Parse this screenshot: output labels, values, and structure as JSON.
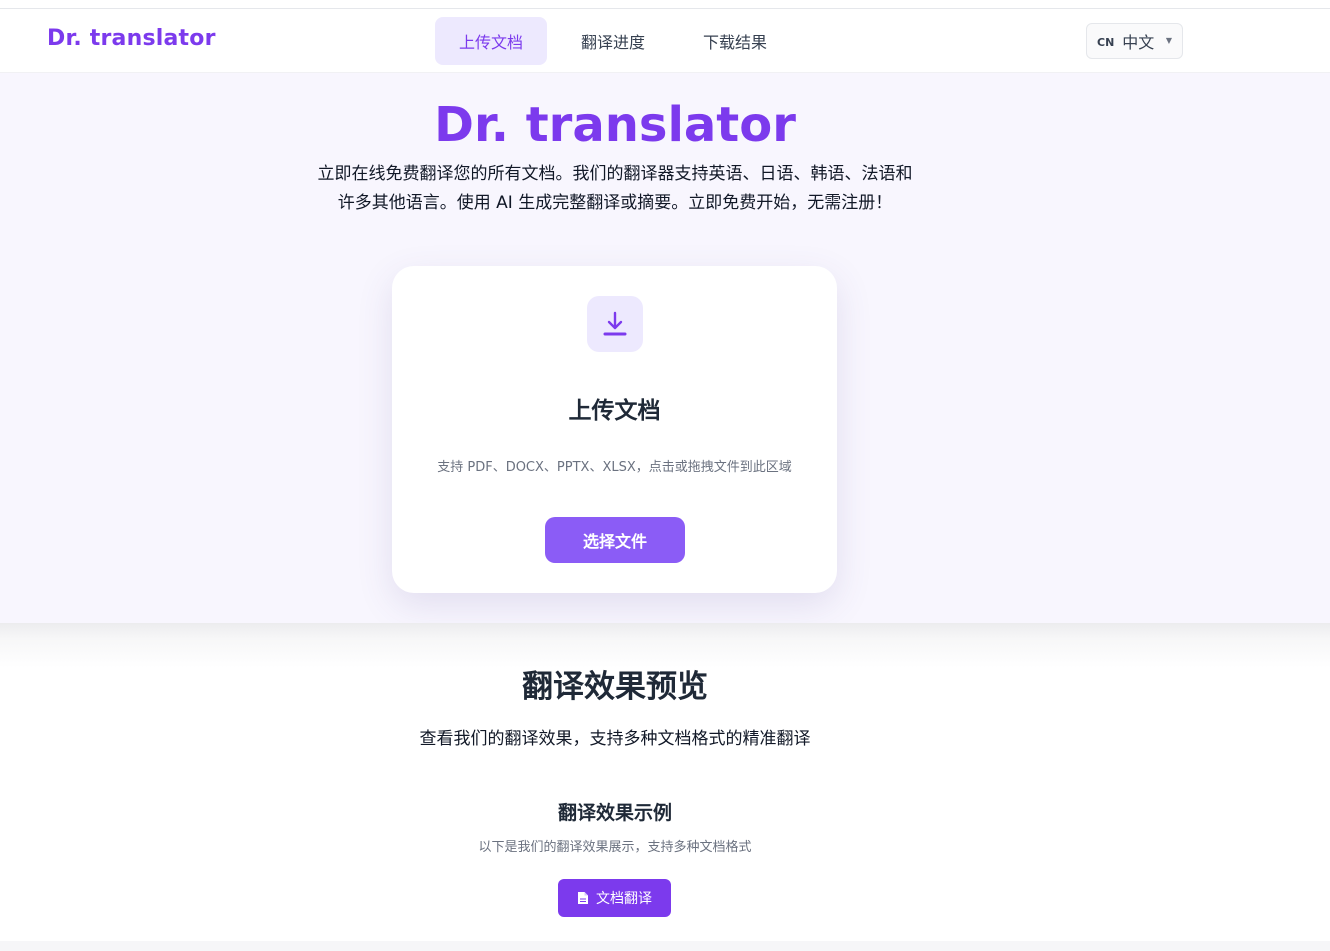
{
  "header": {
    "logo": "Dr. translator",
    "nav": [
      {
        "label": "上传文档",
        "active": true
      },
      {
        "label": "翻译进度",
        "active": false
      },
      {
        "label": "下载结果",
        "active": false
      }
    ],
    "language": {
      "code": "CN",
      "label": "中文"
    }
  },
  "hero": {
    "title": "Dr. translator",
    "description": "立即在线免费翻译您的所有文档。我们的翻译器支持英语、日语、韩语、法语和许多其他语言。使用 AI 生成完整翻译或摘要。立即免费开始，无需注册！"
  },
  "upload": {
    "icon": "download-icon",
    "title": "上传文档",
    "hint": "支持 PDF、DOCX、PPTX、XLSX，点击或拖拽文件到此区域",
    "button": "选择文件"
  },
  "preview": {
    "title": "翻译效果预览",
    "subtitle": "查看我们的翻译效果，支持多种文档格式的精准翻译",
    "example_title": "翻译效果示例",
    "example_subtitle": "以下是我们的翻译效果展示，支持多种文档格式",
    "doc_button": "文档翻译",
    "doc_button_icon": "document-icon"
  },
  "colors": {
    "brand": "#7c3aed",
    "button": "#8b5cf6",
    "hero_bg": "#f8f6fe",
    "active_nav_bg": "#ede9fe"
  }
}
